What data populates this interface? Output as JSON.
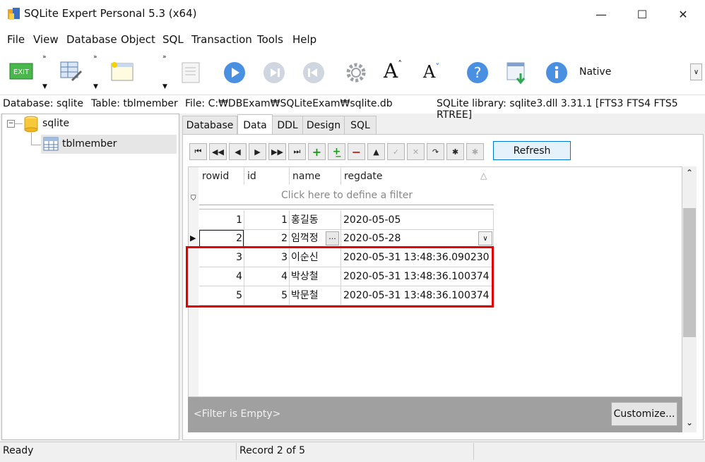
{
  "window": {
    "title": "SQLite Expert Personal 5.3 (x64)",
    "minimize": "—",
    "maximize": "☐",
    "close": "✕"
  },
  "menu": [
    "File",
    "View",
    "Database",
    "Object",
    "SQL",
    "Transaction",
    "Tools",
    "Help"
  ],
  "toolbar": {
    "native_label": "Native",
    "more": "»"
  },
  "info": {
    "database": "Database: sqlite",
    "table": "Table: tblmember",
    "file": "File: C:₩DBExam₩SQLiteExam₩sqlite.db",
    "library": "SQLite library: sqlite3.dll 3.31.1 [FTS3 FTS4 FTS5 RTREE]"
  },
  "tree": {
    "db": "sqlite",
    "table": "tblmember"
  },
  "tabs": [
    "Database",
    "Data",
    "DDL",
    "Design",
    "SQL"
  ],
  "active_tab": "Data",
  "nav": {
    "refresh": "Refresh"
  },
  "grid": {
    "columns": [
      "rowid",
      "id",
      "name",
      "regdate"
    ],
    "filter_hint": "Click here to define a filter",
    "rows": [
      {
        "rowid": "1",
        "id": "1",
        "name": "홍길동",
        "regdate": "2020-05-05"
      },
      {
        "rowid": "2",
        "id": "2",
        "name": "임꺽정",
        "regdate": "2020-05-28"
      },
      {
        "rowid": "3",
        "id": "3",
        "name": "이순신",
        "regdate": "2020-05-31 13:48:36.090230"
      },
      {
        "rowid": "4",
        "id": "4",
        "name": "박상철",
        "regdate": "2020-05-31 13:48:36.100374"
      },
      {
        "rowid": "5",
        "id": "5",
        "name": "박문철",
        "regdate": "2020-05-31 13:48:36.100374"
      }
    ],
    "highlight_color": "#e30000"
  },
  "filter": {
    "empty": "<Filter is Empty>",
    "customize": "Customize..."
  },
  "status": {
    "left": "Ready",
    "record": "Record 2 of 5"
  }
}
